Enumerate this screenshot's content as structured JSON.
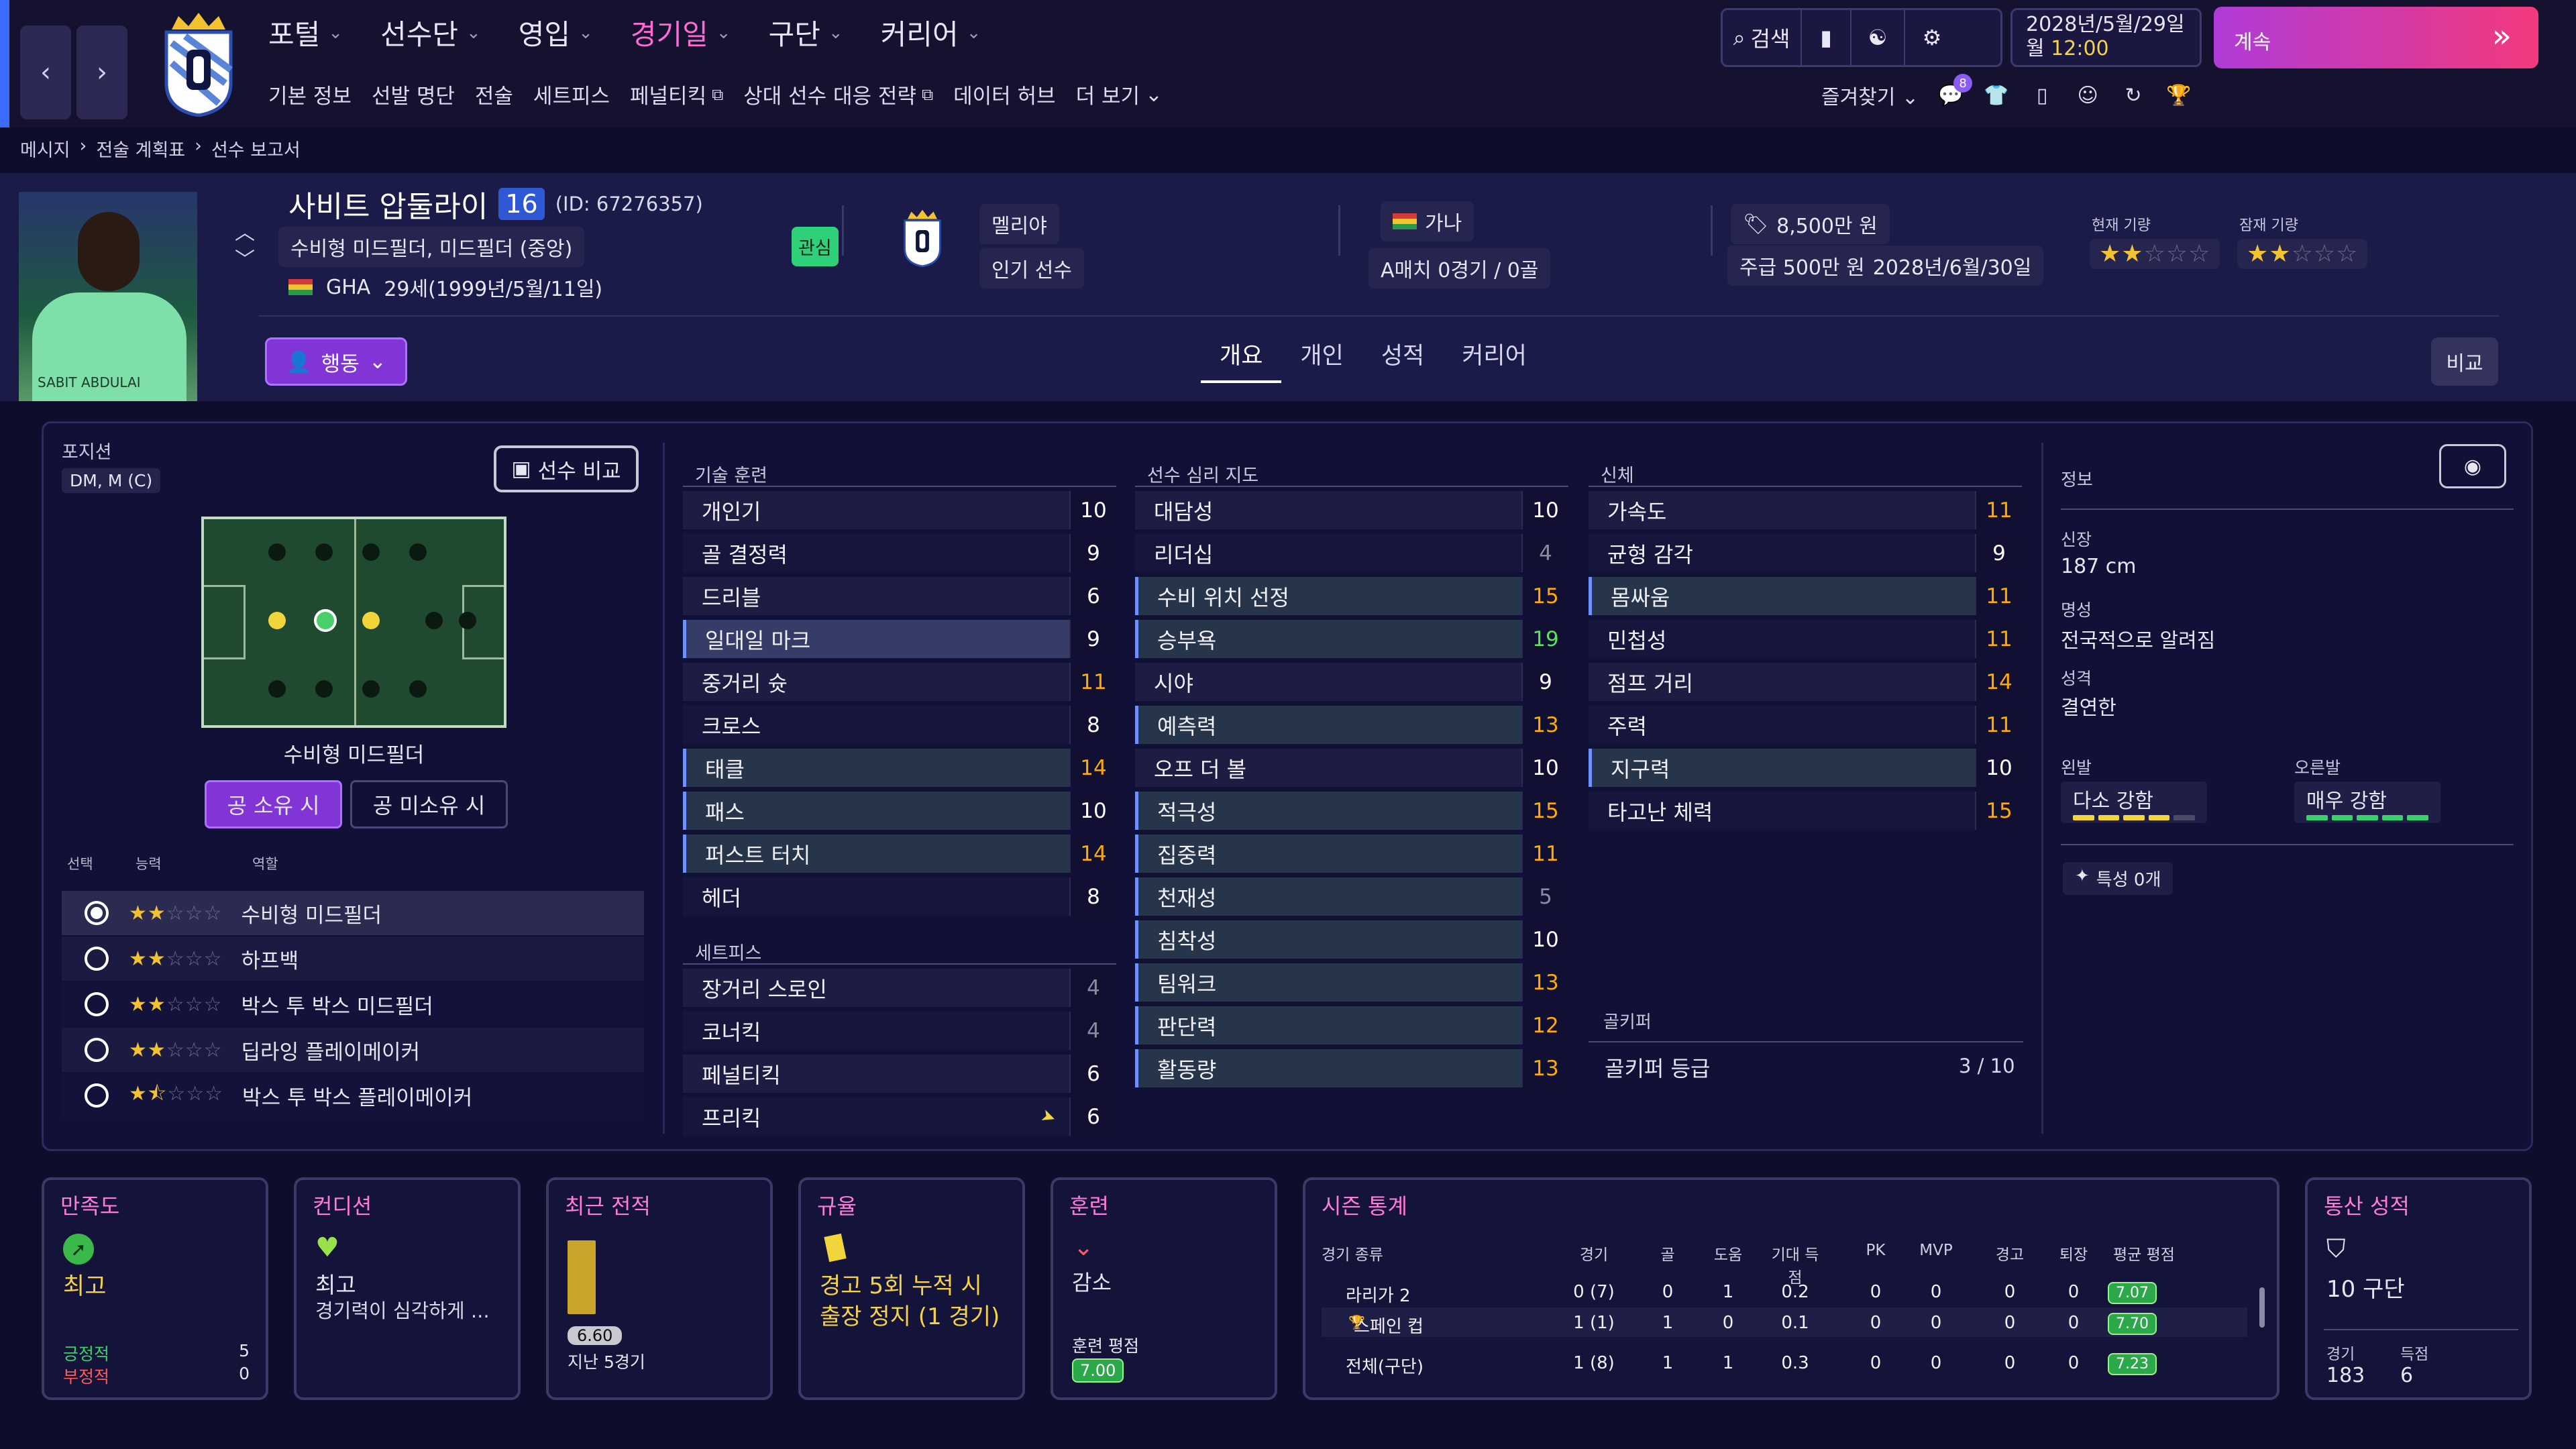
{
  "colors": {
    "accent": "#ff6bd6",
    "bar_orange": "#ffaa00",
    "bar_green": "#5fe05f",
    "chip_green": "#2aa84a"
  },
  "nav": {
    "back_icon": "chevron-left-icon",
    "forward_icon": "chevron-right-icon",
    "main": [
      "포털",
      "선수단",
      "영입",
      "경기일",
      "구단",
      "커리어"
    ],
    "sub": [
      "기본 정보",
      "선발 명단",
      "전술",
      "세트피스",
      "페널티킥",
      "상대 선수 대응 전략",
      "데이터 허브",
      "더 보기"
    ],
    "search": "검색",
    "date_line1": "2028년/5월/29일",
    "date_weekday": "월",
    "date_time": "12:00",
    "continue": "계속",
    "favorites": "즐겨찾기",
    "inbox_count": "8"
  },
  "breadcrumb": [
    "메시지",
    "전술 계획표",
    "선수 보고서"
  ],
  "player": {
    "name": "사비트 압둘라이",
    "number": "16",
    "id": "(ID: 67276357)",
    "positions": "수비형 미드필더, 미드필더 (중앙)",
    "nationality_code": "GHA",
    "age": "29세(1999년/5월/11일)",
    "interest": "관심",
    "club": "멜리야",
    "status": "인기 선수",
    "nation": "가나",
    "caps": "A매치 0경기 / 0골",
    "value": "8,500만 원",
    "contract_wage": "주급 500만 원",
    "contract_end": "2028년/6월/30일",
    "current_ability_label": "현재 기량",
    "potential_ability_label": "잠재 기량",
    "current_ability_stars": 2,
    "potential_ability_stars": 2,
    "shirt_text": "SABIT ABDULAI"
  },
  "actions": {
    "action": "행동",
    "compare": "비교",
    "compare_player": "선수 비교"
  },
  "tabs": [
    "개요",
    "개인",
    "성적",
    "커리어"
  ],
  "position_panel": {
    "label": "포지션",
    "value": "DM, M (C)",
    "role_title": "수비형 미드필더",
    "with_ball": "공 소유 시",
    "without_ball": "공 미소유 시",
    "col_select": "선택",
    "col_ability": "능력",
    "col_role": "역할",
    "roles": [
      {
        "name": "수비형 미드필더",
        "stars": 2,
        "half": false,
        "selected": true
      },
      {
        "name": "하프백",
        "stars": 2,
        "half": false,
        "selected": false
      },
      {
        "name": "박스 투 박스 미드필더",
        "stars": 2,
        "half": false,
        "selected": false
      },
      {
        "name": "딥라잉 플레이메이커",
        "stars": 2,
        "half": false,
        "selected": false
      },
      {
        "name": "박스 투 박스 플레이메이커",
        "stars": 1,
        "half": true,
        "selected": false
      }
    ]
  },
  "technical": {
    "label": "기술 훈련",
    "items": [
      {
        "name": "개인기",
        "value": "10",
        "hl": false
      },
      {
        "name": "골 결정력",
        "value": "9",
        "hl": false
      },
      {
        "name": "드리블",
        "value": "6",
        "hl": false
      },
      {
        "name": "일대일 마크",
        "value": "9",
        "hl": true
      },
      {
        "name": "중거리 슛",
        "value": "11",
        "hl": false
      },
      {
        "name": "크로스",
        "value": "8",
        "hl": false
      },
      {
        "name": "태클",
        "value": "14",
        "hl": true
      },
      {
        "name": "패스",
        "value": "10",
        "hl": true
      },
      {
        "name": "퍼스트 터치",
        "value": "14",
        "hl": true
      },
      {
        "name": "헤더",
        "value": "8",
        "hl": false
      }
    ]
  },
  "setpieces": {
    "label": "세트피스",
    "items": [
      {
        "name": "장거리 스로인",
        "value": "4",
        "hl": false
      },
      {
        "name": "코너킥",
        "value": "4",
        "hl": false
      },
      {
        "name": "페널티킥",
        "value": "6",
        "hl": false
      },
      {
        "name": "프리킥",
        "value": "6",
        "hl": false
      }
    ]
  },
  "mental": {
    "label": "선수 심리 지도",
    "items": [
      {
        "name": "대담성",
        "value": "10",
        "hl": false
      },
      {
        "name": "리더십",
        "value": "4",
        "hl": false
      },
      {
        "name": "수비 위치 선정",
        "value": "15",
        "hl": true
      },
      {
        "name": "승부욕",
        "value": "19",
        "hl": true
      },
      {
        "name": "시야",
        "value": "9",
        "hl": false
      },
      {
        "name": "예측력",
        "value": "13",
        "hl": true
      },
      {
        "name": "오프 더 볼",
        "value": "10",
        "hl": false
      },
      {
        "name": "적극성",
        "value": "15",
        "hl": true
      },
      {
        "name": "집중력",
        "value": "11",
        "hl": true
      },
      {
        "name": "천재성",
        "value": "5",
        "hl": true
      },
      {
        "name": "침착성",
        "value": "10",
        "hl": true
      },
      {
        "name": "팀워크",
        "value": "13",
        "hl": true
      },
      {
        "name": "판단력",
        "value": "12",
        "hl": true
      },
      {
        "name": "활동량",
        "value": "13",
        "hl": true
      }
    ]
  },
  "physical": {
    "label": "신체",
    "items": [
      {
        "name": "가속도",
        "value": "11",
        "hl": false
      },
      {
        "name": "균형 감각",
        "value": "9",
        "hl": false
      },
      {
        "name": "몸싸움",
        "value": "11",
        "hl": true
      },
      {
        "name": "민첩성",
        "value": "11",
        "hl": false
      },
      {
        "name": "점프 거리",
        "value": "14",
        "hl": false
      },
      {
        "name": "주력",
        "value": "11",
        "hl": false
      },
      {
        "name": "지구력",
        "value": "10",
        "hl": true
      },
      {
        "name": "타고난 체력",
        "value": "15",
        "hl": false
      }
    ]
  },
  "goalkeeper": {
    "label": "골키퍼",
    "rating_label": "골키퍼 등급",
    "rating": "3 / 10"
  },
  "info": {
    "label": "정보",
    "height_label": "신장",
    "height": "187 cm",
    "fame_label": "명성",
    "fame": "전국적으로 알려짐",
    "personality_label": "성격",
    "personality": "결연한",
    "left_foot_label": "왼발",
    "left_foot": "다소 강함",
    "left_foot_level": 4,
    "right_foot_label": "오른발",
    "right_foot": "매우 강함",
    "right_foot_level": 5,
    "traits": "특성 0개"
  },
  "cards": {
    "morale": {
      "title": "만족도",
      "value": "최고",
      "pos_label": "긍정적",
      "pos": "5",
      "neg_label": "부정적",
      "neg": "0"
    },
    "condition": {
      "title": "컨디션",
      "value": "최고",
      "note": "경기력이 심각하게 ..."
    },
    "form": {
      "title": "최근 전적",
      "rating": "6.60",
      "note": "지난 5경기"
    },
    "discipline": {
      "title": "규율",
      "text": "경고 5회 누적 시 출장 정지 (1 경기)"
    },
    "training": {
      "title": "훈련",
      "value": "감소",
      "rating_label": "훈련 평점",
      "rating": "7.00"
    },
    "season": {
      "title": "시즌 통계",
      "headers": [
        "경기 종류",
        "경기",
        "골",
        "도움",
        "기대 득점",
        "PK",
        "MVP",
        "경고",
        "퇴장",
        "평균 평점"
      ],
      "rows": [
        [
          "라리가 2",
          "0 (7)",
          "0",
          "1",
          "0.2",
          "0",
          "0",
          "0",
          "0",
          "7.07"
        ],
        [
          "스페인 컵",
          "1 (1)",
          "1",
          "0",
          "0.1",
          "0",
          "0",
          "0",
          "0",
          "7.70"
        ],
        [
          "전체(구단)",
          "1 (8)",
          "1",
          "1",
          "0.3",
          "0",
          "0",
          "0",
          "0",
          "7.23"
        ]
      ]
    },
    "career": {
      "title": "통산 성적",
      "clubs": "10 구단",
      "apps_label": "경기",
      "apps": "183",
      "goals_label": "득점",
      "goals": "6"
    }
  }
}
